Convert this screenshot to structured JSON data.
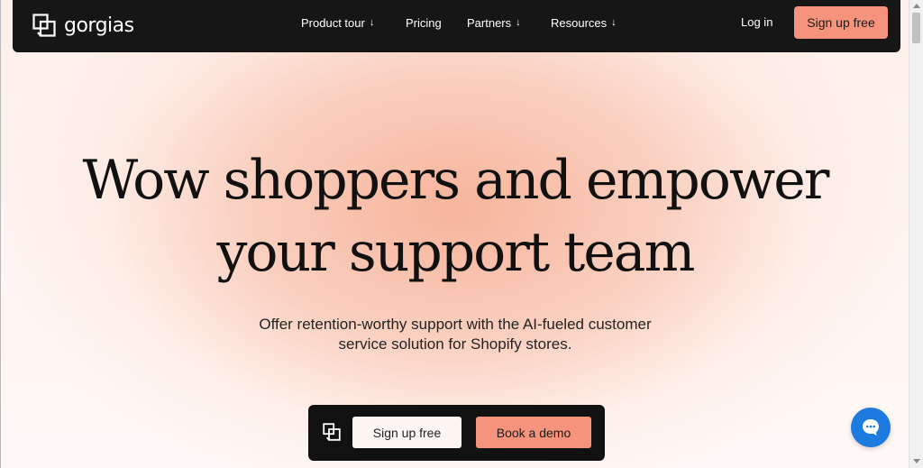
{
  "nav": {
    "logo_text": "gorgias",
    "links": [
      {
        "label": "Product tour",
        "arrow": "↓"
      },
      {
        "label": "Pricing",
        "arrow": ""
      },
      {
        "label": "Partners",
        "arrow": "↓"
      },
      {
        "label": "Resources",
        "arrow": "↓"
      }
    ],
    "login_label": "Log in",
    "signup_label": "Sign up free"
  },
  "hero": {
    "title_line1": "Wow shoppers and empower",
    "title_line2": "your support team",
    "subtitle_line1": "Offer retention-worthy support with the AI-fueled customer",
    "subtitle_line2": "service solution for Shopify stores."
  },
  "cta": {
    "signup_label": "Sign up free",
    "demo_label": "Book a demo"
  },
  "icons": {
    "logo": "gorgias-logo-icon",
    "cta": "gorgias-logo-icon",
    "chat": "chat-bubble-icon"
  },
  "colors": {
    "nav_bg": "#161616",
    "accent": "#f5937c",
    "chat": "#1d7be0"
  }
}
